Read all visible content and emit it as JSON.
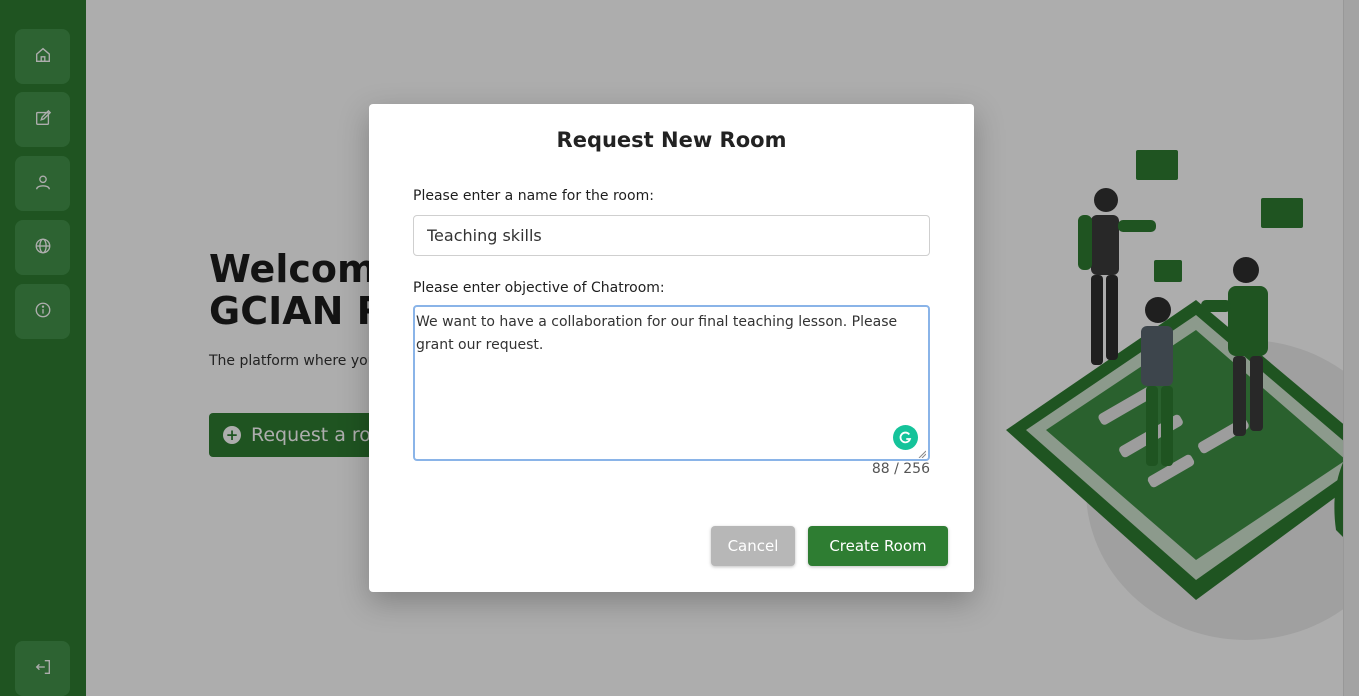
{
  "sidebar": {
    "items": [
      {
        "icon": "home-icon"
      },
      {
        "icon": "edit-icon"
      },
      {
        "icon": "user-icon"
      },
      {
        "icon": "globe-icon"
      },
      {
        "icon": "info-icon"
      }
    ],
    "logout_icon": "logout-icon"
  },
  "hero": {
    "title_line1": "Welcome",
    "title_line2": "GCIAN R",
    "description": "The platform where you fellow students.",
    "request_button": "Request a ro"
  },
  "modal": {
    "title": "Request New Room",
    "name_label": "Please enter a name for the room:",
    "name_value": "Teaching skills",
    "objective_label": "Please enter objective of Chatroom:",
    "objective_value": "We want to have a collaboration for our final teaching lesson. Please grant our request.",
    "counter": "88 / 256",
    "cancel_label": "Cancel",
    "create_label": "Create Room"
  },
  "colors": {
    "brand_green": "#2e7d32",
    "sidebar_button": "#43934a",
    "cancel_grey": "#b7b7b7",
    "grammarly": "#15c39a",
    "focus_border": "#8ab4e8"
  }
}
